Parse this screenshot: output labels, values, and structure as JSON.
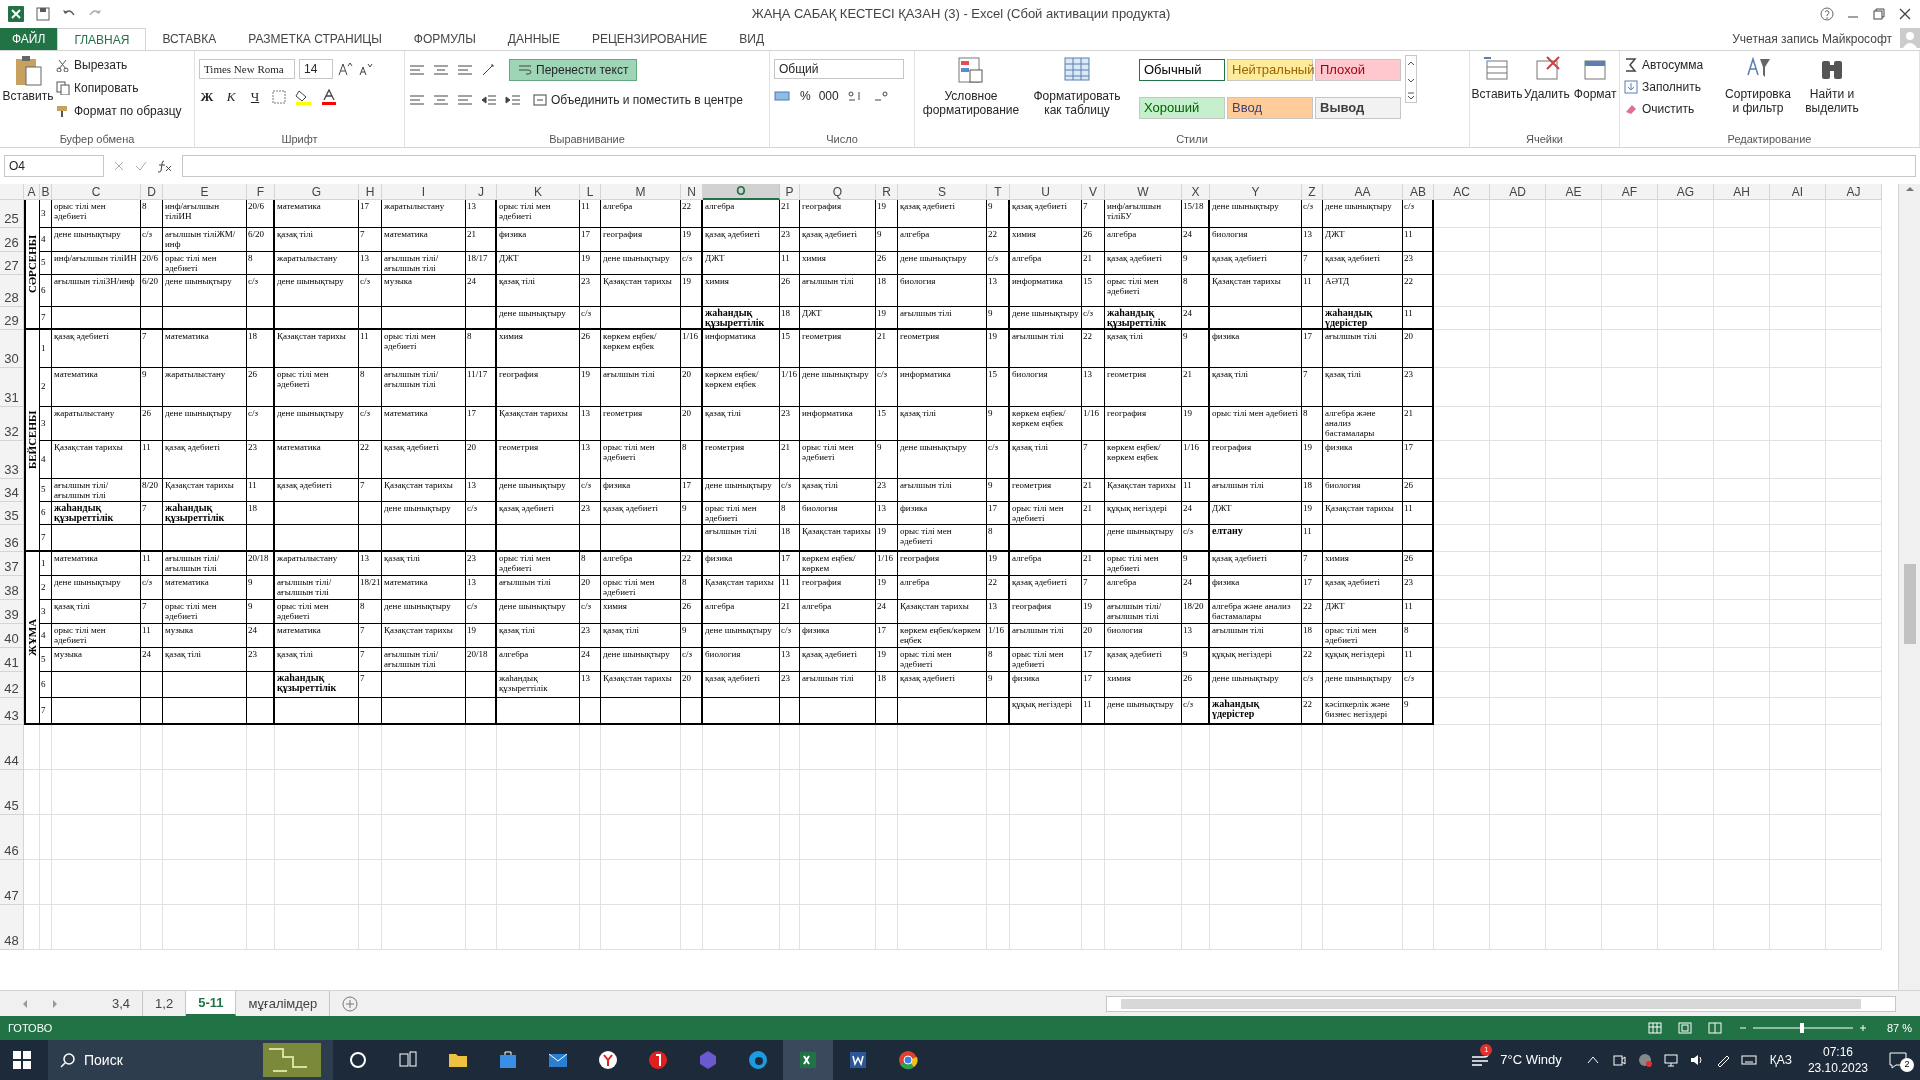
{
  "window": {
    "title": "ЖАҢА САБАҚ КЕСТЕСІ ҚАЗАН (3) - Excel (Сбой активации продукта)",
    "account": "Учетная запись Майкрософт"
  },
  "tabs": [
    {
      "label": "ФАЙЛ",
      "kind": "file",
      "selected": false
    },
    {
      "label": "ГЛАВНАЯ",
      "kind": "tab",
      "selected": true
    },
    {
      "label": "ВСТАВКА",
      "kind": "tab",
      "selected": false
    },
    {
      "label": "РАЗМЕТКА СТРАНИЦЫ",
      "kind": "tab",
      "selected": false
    },
    {
      "label": "ФОРМУЛЫ",
      "kind": "tab",
      "selected": false
    },
    {
      "label": "ДАННЫЕ",
      "kind": "tab",
      "selected": false
    },
    {
      "label": "РЕЦЕНЗИРОВАНИЕ",
      "kind": "tab",
      "selected": false
    },
    {
      "label": "ВИД",
      "kind": "tab",
      "selected": false
    }
  ],
  "ribbon": {
    "clipboard": {
      "label": "Буфер обмена",
      "paste": "Вставить",
      "items": [
        "Вырезать",
        "Копировать",
        "Формат по образцу"
      ]
    },
    "font": {
      "label": "Шрифт",
      "family": "Times New Roma",
      "size": "14",
      "styles": [
        "Ж",
        "К",
        "Ч"
      ]
    },
    "alignment": {
      "label": "Выравнивание",
      "wrap_text": {
        "text": "Перенести текст",
        "on": true
      },
      "merge": "Объединить и поместить в центре"
    },
    "number": {
      "label": "Число",
      "format": "Общий",
      "symbols": [
        "%",
        "000"
      ]
    },
    "styles": {
      "label": "Стили",
      "conditional": "Условное форматирование",
      "as_table": "Форматировать как таблицу",
      "cell_styles": [
        {
          "text": "Обычный",
          "color": "#ffffff"
        },
        {
          "text": "Нейтральный",
          "color": "#ffeb9c"
        },
        {
          "text": "Плохой",
          "color": "#ffc7ce"
        },
        {
          "text": "Хороший",
          "color": "#c6efce"
        },
        {
          "text": "Ввод",
          "color": "#ffcc99"
        },
        {
          "text": "Вывод",
          "color": "#f2f2f2"
        }
      ]
    },
    "cells": {
      "label": "Ячейки",
      "buttons": [
        "Вставить",
        "Удалить",
        "Формат"
      ]
    },
    "editing": {
      "label": "Редактирование",
      "items": [
        "Автосумма",
        "Заполнить",
        "Очистить"
      ],
      "buttons": [
        "Сортировка и фильтр",
        "Найти и выделить"
      ]
    }
  },
  "name_box": "O4",
  "columns": [
    {
      "letter": "A",
      "selected": false
    },
    {
      "letter": "B",
      "selected": false
    },
    {
      "letter": "C",
      "selected": false
    },
    {
      "letter": "D",
      "selected": false
    },
    {
      "letter": "E",
      "selected": false
    },
    {
      "letter": "F",
      "selected": false
    },
    {
      "letter": "G",
      "selected": false
    },
    {
      "letter": "H",
      "selected": false
    },
    {
      "letter": "I",
      "selected": false
    },
    {
      "letter": "J",
      "selected": false
    },
    {
      "letter": "K",
      "selected": false
    },
    {
      "letter": "L",
      "selected": false
    },
    {
      "letter": "M",
      "selected": false
    },
    {
      "letter": "N",
      "selected": false
    },
    {
      "letter": "O",
      "selected": true
    },
    {
      "letter": "P",
      "selected": false
    },
    {
      "letter": "Q",
      "selected": false
    },
    {
      "letter": "R",
      "selected": false
    },
    {
      "letter": "S",
      "selected": false
    },
    {
      "letter": "T",
      "selected": false
    },
    {
      "letter": "U",
      "selected": false
    },
    {
      "letter": "V",
      "selected": false
    },
    {
      "letter": "W",
      "selected": false
    },
    {
      "letter": "X",
      "selected": false
    },
    {
      "letter": "Y",
      "selected": false
    },
    {
      "letter": "Z",
      "selected": false
    },
    {
      "letter": "AA",
      "selected": false
    },
    {
      "letter": "AB",
      "selected": false
    },
    {
      "letter": "AC",
      "selected": false
    },
    {
      "letter": "AD",
      "selected": false
    },
    {
      "letter": "AE",
      "selected": false
    },
    {
      "letter": "AF",
      "selected": false
    },
    {
      "letter": "AG",
      "selected": false
    },
    {
      "letter": "AH",
      "selected": false
    },
    {
      "letter": "AI",
      "selected": false
    },
    {
      "letter": "AJ",
      "selected": false
    }
  ],
  "days": [
    {
      "day": "СӘРСЕНБІ",
      "lessons": [
        {
          "row": "25",
          "number": "3",
          "cells": [
            {
              "subject": "орыс тілі мен әдебиеті",
              "room": "8",
              "bold": false
            },
            {
              "subject": "инф/ағылшын тіліИН",
              "room": "20/6",
              "bold": false
            },
            {
              "subject": "математика",
              "room": "17",
              "bold": false
            },
            {
              "subject": "жаратылыстану",
              "room": "13",
              "bold": false
            },
            {
              "subject": "орыс тілі мен әдебиеті",
              "room": "11",
              "bold": false
            },
            {
              "subject": "алгебра",
              "room": "22",
              "bold": false
            },
            {
              "subject": "алгебра",
              "room": "21",
              "bold": false
            },
            {
              "subject": "география",
              "room": "19",
              "bold": false
            },
            {
              "subject": "қазақ әдебиеті",
              "room": "9",
              "bold": false
            },
            {
              "subject": "қазақ әдебиеті",
              "room": "7",
              "bold": false
            },
            {
              "subject": "инф/ағылшын тіліБУ",
              "room": "15/18",
              "bold": false
            },
            {
              "subject": "дене шынықтыру",
              "room": "с/з",
              "bold": false
            },
            {
              "subject": "дене шынықтыру",
              "room": "с/з",
              "bold": false
            }
          ]
        },
        {
          "row": "26",
          "number": "4",
          "cells": [
            {
              "subject": "дене шынықтыру",
              "room": "с/з",
              "bold": false
            },
            {
              "subject": "ағылшын тіліЖМ/инф",
              "room": "6/20",
              "bold": false
            },
            {
              "subject": "қазақ тілі",
              "room": "7",
              "bold": false
            },
            {
              "subject": "математика",
              "room": "21",
              "bold": false
            },
            {
              "subject": "физика",
              "room": "17",
              "bold": false
            },
            {
              "subject": "география",
              "room": "19",
              "bold": false
            },
            {
              "subject": "қазақ әдебиеті",
              "room": "23",
              "bold": false
            },
            {
              "subject": "қазақ әдебиеті",
              "room": "9",
              "bold": false
            },
            {
              "subject": "алгебра",
              "room": "22",
              "bold": false
            },
            {
              "subject": "химия",
              "room": "26",
              "bold": false
            },
            {
              "subject": "алгебра",
              "room": "24",
              "bold": false
            },
            {
              "subject": "биология",
              "room": "13",
              "bold": false
            },
            {
              "subject": "ДЖТ",
              "room": "11",
              "bold": false
            }
          ]
        },
        {
          "row": "27",
          "number": "5",
          "cells": [
            {
              "subject": "инф/ағылшын тіліИН",
              "room": "20/6",
              "bold": false
            },
            {
              "subject": "орыс тілі мен әдебиеті",
              "room": "8",
              "bold": false
            },
            {
              "subject": "жаратылыстану",
              "room": "13",
              "bold": false
            },
            {
              "subject": "ағылшын тілі/ағылшын тілі",
              "room": "18/17",
              "bold": false
            },
            {
              "subject": "ДЖТ",
              "room": "19",
              "bold": false
            },
            {
              "subject": "дене шынықтыру",
              "room": "с/з",
              "bold": false
            },
            {
              "subject": "ДЖТ",
              "room": "11",
              "bold": false
            },
            {
              "subject": "химия",
              "room": "26",
              "bold": false
            },
            {
              "subject": "дене шынықтыру",
              "room": "с/з",
              "bold": false
            },
            {
              "subject": "алгебра",
              "room": "21",
              "bold": false
            },
            {
              "subject": "қазақ әдебиеті",
              "room": "9",
              "bold": false
            },
            {
              "subject": "қазақ әдебиеті",
              "room": "7",
              "bold": false
            },
            {
              "subject": "қазақ әдебиеті",
              "room": "23",
              "bold": false
            }
          ]
        },
        {
          "row": "28",
          "number": "6",
          "cells": [
            {
              "subject": "ағылшын тіліЗН/инф",
              "room": "6/20",
              "bold": false
            },
            {
              "subject": "дене шынықтыру",
              "room": "с/з",
              "bold": false
            },
            {
              "subject": "дене шынықтыру",
              "room": "с/з",
              "bold": false
            },
            {
              "subject": "музыка",
              "room": "24",
              "bold": false
            },
            {
              "subject": "қазақ тілі",
              "room": "23",
              "bold": false
            },
            {
              "subject": "Қазақстан тарихы",
              "room": "19",
              "bold": false
            },
            {
              "subject": "химия",
              "room": "26",
              "bold": false
            },
            {
              "subject": "ағылшын тілі",
              "room": "18",
              "bold": false
            },
            {
              "subject": "биология",
              "room": "13",
              "bold": false
            },
            {
              "subject": "информатика",
              "room": "15",
              "bold": false
            },
            {
              "subject": "орыс тілі мен әдебиеті",
              "room": "8",
              "bold": false
            },
            {
              "subject": "Қазақстан тарихы",
              "room": "11",
              "bold": false
            },
            {
              "subject": "АӘТД",
              "room": "22",
              "bold": false
            }
          ]
        },
        {
          "row": "29",
          "number": "7",
          "cells": [
            null,
            null,
            null,
            null,
            {
              "subject": "дене шынықтыру",
              "room": "с/з",
              "bold": false
            },
            null,
            {
              "subject": "жаһандық құзыреттілік",
              "room": "18",
              "bold": true
            },
            {
              "subject": "ДЖТ",
              "room": "19",
              "bold": false
            },
            {
              "subject": "ағылшын тілі",
              "room": "9",
              "bold": false
            },
            {
              "subject": "дене шынықтыру",
              "room": "с/з",
              "bold": false
            },
            {
              "subject": "жаһандық құзыреттілік",
              "room": "24",
              "bold": true
            },
            null,
            {
              "subject": "жаһандық үдерістер",
              "room": "11",
              "bold": true
            }
          ]
        }
      ]
    },
    {
      "day": "БЕЙСЕНБІ",
      "lessons": [
        {
          "row": "30",
          "number": "1",
          "cells": [
            {
              "subject": "қазақ әдебиеті",
              "room": "7",
              "bold": false
            },
            {
              "subject": "математика",
              "room": "18",
              "bold": false
            },
            {
              "subject": "Қазақстан тарихы",
              "room": "11",
              "bold": false
            },
            {
              "subject": "орыс тілі мен әдебиеті",
              "room": "8",
              "bold": false
            },
            {
              "subject": "химия",
              "room": "26",
              "bold": false
            },
            {
              "subject": "көркем еңбек/көркем еңбек",
              "room": "1/16",
              "bold": false
            },
            {
              "subject": "информатика",
              "room": "15",
              "bold": false
            },
            {
              "subject": "геометрия",
              "room": "21",
              "bold": false
            },
            {
              "subject": "геометрия",
              "room": "19",
              "bold": false
            },
            {
              "subject": "ағылшын тілі",
              "room": "22",
              "bold": false
            },
            {
              "subject": "қазақ тілі",
              "room": "9",
              "bold": false
            },
            {
              "subject": "физика",
              "room": "17",
              "bold": false
            },
            {
              "subject": "ағылшын тілі",
              "room": "20",
              "bold": false
            }
          ]
        },
        {
          "row": "31",
          "number": "2",
          "cells": [
            {
              "subject": "математика",
              "room": "9",
              "bold": false
            },
            {
              "subject": "жаратылыстану",
              "room": "26",
              "bold": false
            },
            {
              "subject": "орыс тілі мен әдебиеті",
              "room": "8",
              "bold": false
            },
            {
              "subject": "ағылшын тілі/ағылшын тілі",
              "room": "11/17",
              "bold": false
            },
            {
              "subject": "география",
              "room": "19",
              "bold": false
            },
            {
              "subject": "ағылшын тілі",
              "room": "20",
              "bold": false
            },
            {
              "subject": "көркем еңбек/көркем еңбек",
              "room": "1/16",
              "bold": false
            },
            {
              "subject": "дене шынықтыру",
              "room": "с/з",
              "bold": false
            },
            {
              "subject": "информатика",
              "room": "15",
              "bold": false
            },
            {
              "subject": "биология",
              "room": "13",
              "bold": false
            },
            {
              "subject": "геометрия",
              "room": "21",
              "bold": false
            },
            {
              "subject": "қазақ тілі",
              "room": "7",
              "bold": false
            },
            {
              "subject": "қазақ тілі",
              "room": "23",
              "bold": false
            }
          ]
        },
        {
          "row": "32",
          "number": "3",
          "cells": [
            {
              "subject": "жаратылыстану",
              "room": "26",
              "bold": false
            },
            {
              "subject": "дене шынықтыру",
              "room": "с/з",
              "bold": false
            },
            {
              "subject": "дене шынықтыру",
              "room": "с/з",
              "bold": false
            },
            {
              "subject": "математика",
              "room": "17",
              "bold": false
            },
            {
              "subject": "Қазақстан тарихы",
              "room": "13",
              "bold": false
            },
            {
              "subject": "геометрия",
              "room": "20",
              "bold": false
            },
            {
              "subject": "қазақ тілі",
              "room": "23",
              "bold": false
            },
            {
              "subject": "информатика",
              "room": "15",
              "bold": false
            },
            {
              "subject": "қазақ тілі",
              "room": "9",
              "bold": false
            },
            {
              "subject": "көркем еңбек/көркем еңбек",
              "room": "1/16",
              "bold": false
            },
            {
              "subject": "география",
              "room": "19",
              "bold": false
            },
            {
              "subject": "орыс тілі мен әдебиеті",
              "room": "8",
              "bold": false
            },
            {
              "subject": "алгебра және анализ бастамалары",
              "room": "21",
              "bold": false
            }
          ]
        },
        {
          "row": "33",
          "number": "4",
          "cells": [
            {
              "subject": "Қазақстан тарихы",
              "room": "11",
              "bold": false
            },
            {
              "subject": "қазақ әдебиеті",
              "room": "23",
              "bold": false
            },
            {
              "subject": "математика",
              "room": "22",
              "bold": false
            },
            {
              "subject": "қазақ әдебиеті",
              "room": "20",
              "bold": false
            },
            {
              "subject": "геометрия",
              "room": "13",
              "bold": false
            },
            {
              "subject": "орыс тілі мен әдебиеті",
              "room": "8",
              "bold": false
            },
            {
              "subject": "геометрия",
              "room": "21",
              "bold": false
            },
            {
              "subject": "орыс тілі мен әдебиеті",
              "room": "9",
              "bold": false
            },
            {
              "subject": "дене шынықтыру",
              "room": "с/з",
              "bold": false
            },
            {
              "subject": "қазақ тілі",
              "room": "7",
              "bold": false
            },
            {
              "subject": "көркем еңбек/көркем еңбек",
              "room": "1/16",
              "bold": false
            },
            {
              "subject": "география",
              "room": "19",
              "bold": false
            },
            {
              "subject": "физика",
              "room": "17",
              "bold": false
            }
          ]
        },
        {
          "row": "34",
          "number": "5",
          "cells": [
            {
              "subject": "ағылшын тілі/ағылшын тілі",
              "room": "8/20",
              "bold": false
            },
            {
              "subject": "Қазақстан тарихы",
              "room": "11",
              "bold": false
            },
            {
              "subject": "қазақ әдебиеті",
              "room": "7",
              "bold": false
            },
            {
              "subject": "Қазақстан тарихы",
              "room": "13",
              "bold": false
            },
            {
              "subject": "дене шынықтыру",
              "room": "с/з",
              "bold": false
            },
            {
              "subject": "физика",
              "room": "17",
              "bold": false
            },
            {
              "subject": "дене шынықтыру",
              "room": "с/з",
              "bold": false
            },
            {
              "subject": "қазақ тілі",
              "room": "23",
              "bold": false
            },
            {
              "subject": "ағылшын тілі",
              "room": "9",
              "bold": false
            },
            {
              "subject": "геометрия",
              "room": "21",
              "bold": false
            },
            {
              "subject": "Қазақстан тарихы",
              "room": "11",
              "bold": false
            },
            {
              "subject": "ағылшын тілі",
              "room": "18",
              "bold": false
            },
            {
              "subject": "биология",
              "room": "26",
              "bold": false
            }
          ]
        },
        {
          "row": "35",
          "number": "6",
          "cells": [
            {
              "subject": "жаһандық құзыреттілік",
              "room": "7",
              "bold": true
            },
            {
              "subject": "жаһандық құзыреттілік",
              "room": "18",
              "bold": true
            },
            null,
            {
              "subject": "дене шынықтыру",
              "room": "с/з",
              "bold": false
            },
            {
              "subject": "қазақ әдебиеті",
              "room": "23",
              "bold": false
            },
            {
              "subject": "қазақ әдебиеті",
              "room": "9",
              "bold": false
            },
            {
              "subject": "орыс тілі мен әдебиеті",
              "room": "8",
              "bold": false
            },
            {
              "subject": "биология",
              "room": "13",
              "bold": false
            },
            {
              "subject": "физика",
              "room": "17",
              "bold": false
            },
            {
              "subject": "орыс тілі мен әдебиеті",
              "room": "21",
              "bold": false
            },
            {
              "subject": "құқық негіздері",
              "room": "24",
              "bold": false
            },
            {
              "subject": "ДЖТ",
              "room": "19",
              "bold": false
            },
            {
              "subject": "Қазақстан тарихы",
              "room": "11",
              "bold": false
            }
          ]
        },
        {
          "row": "36",
          "number": "7",
          "cells": [
            null,
            null,
            null,
            null,
            null,
            null,
            {
              "subject": "ағылшын тілі",
              "room": "18",
              "bold": false
            },
            {
              "subject": "Қазақстан тарихы",
              "room": "19",
              "bold": false
            },
            {
              "subject": "орыс тілі мен әдебиеті",
              "room": "8",
              "bold": false
            },
            null,
            {
              "subject": "дене шынықтыру",
              "room": "с/з",
              "bold": false
            },
            {
              "subject": "елтану",
              "room": "11",
              "bold": true
            },
            null
          ]
        }
      ]
    },
    {
      "day": "ЖҰМА",
      "lessons": [
        {
          "row": "37",
          "number": "1",
          "cells": [
            {
              "subject": "математика",
              "room": "11",
              "bold": false
            },
            {
              "subject": "ағылшын тілі/ағылшын тілі",
              "room": "20/18",
              "bold": false
            },
            {
              "subject": "жаратылыстану",
              "room": "13",
              "bold": false
            },
            {
              "subject": "қазақ тілі",
              "room": "23",
              "bold": false
            },
            {
              "subject": "орыс тілі мен әдебиеті",
              "room": "8",
              "bold": false
            },
            {
              "subject": "алгебра",
              "room": "22",
              "bold": false
            },
            {
              "subject": "физика",
              "room": "17",
              "bold": false
            },
            {
              "subject": "көркем еңбек/көркем",
              "room": "1/16",
              "bold": false
            },
            {
              "subject": "география",
              "room": "19",
              "bold": false
            },
            {
              "subject": "алгебра",
              "room": "21",
              "bold": false
            },
            {
              "subject": "орыс тілі мен әдебиеті",
              "room": "9",
              "bold": false
            },
            {
              "subject": "қазақ әдебиеті",
              "room": "7",
              "bold": false
            },
            {
              "subject": "химия",
              "room": "26",
              "bold": false
            }
          ]
        },
        {
          "row": "38",
          "number": "2",
          "cells": [
            {
              "subject": "дене шынықтыру",
              "room": "с/з",
              "bold": false
            },
            {
              "subject": "математика",
              "room": "9",
              "bold": false
            },
            {
              "subject": "ағылшын тілі/ағылшын тілі",
              "room": "18/21",
              "bold": false
            },
            {
              "subject": "математика",
              "room": "13",
              "bold": false
            },
            {
              "subject": "ағылшын тілі",
              "room": "20",
              "bold": false
            },
            {
              "subject": "орыс тілі мен әдебиеті",
              "room": "8",
              "bold": false
            },
            {
              "subject": "Қазақстан тарихы",
              "room": "11",
              "bold": false
            },
            {
              "subject": "география",
              "room": "19",
              "bold": false
            },
            {
              "subject": "алгебра",
              "room": "22",
              "bold": false
            },
            {
              "subject": "қазақ әдебиеті",
              "room": "7",
              "bold": false
            },
            {
              "subject": "алгебра",
              "room": "24",
              "bold": false
            },
            {
              "subject": "физика",
              "room": "17",
              "bold": false
            },
            {
              "subject": "қазақ әдебиеті",
              "room": "23",
              "bold": false
            }
          ]
        },
        {
          "row": "39",
          "number": "3",
          "cells": [
            {
              "subject": "қазақ тілі",
              "room": "7",
              "bold": false
            },
            {
              "subject": "орыс тілі мен әдебиеті",
              "room": "9",
              "bold": false
            },
            {
              "subject": "орыс тілі мен әдебиеті",
              "room": "8",
              "bold": false
            },
            {
              "subject": "дене шынықтыру",
              "room": "с/з",
              "bold": false
            },
            {
              "subject": "дене шынықтыру",
              "room": "с/з",
              "bold": false
            },
            {
              "subject": "химия",
              "room": "26",
              "bold": false
            },
            {
              "subject": "алгебра",
              "room": "21",
              "bold": false
            },
            {
              "subject": "алгебра",
              "room": "24",
              "bold": false
            },
            {
              "subject": "Қазақстан тарихы",
              "room": "13",
              "bold": false
            },
            {
              "subject": "география",
              "room": "19",
              "bold": false
            },
            {
              "subject": "ағылшын тілі/ағылшын тілі",
              "room": "18/20",
              "bold": false
            },
            {
              "subject": "алгебра және анализ бастамалары",
              "room": "22",
              "bold": false
            },
            {
              "subject": "ДЖТ",
              "room": "11",
              "bold": false
            }
          ]
        },
        {
          "row": "40",
          "number": "4",
          "cells": [
            {
              "subject": "орыс тілі мен әдебиеті",
              "room": "11",
              "bold": false
            },
            {
              "subject": "музыка",
              "room": "24",
              "bold": false
            },
            {
              "subject": "математика",
              "room": "7",
              "bold": false
            },
            {
              "subject": "Қазақстан тарихы",
              "room": "19",
              "bold": false
            },
            {
              "subject": "қазақ тілі",
              "room": "23",
              "bold": false
            },
            {
              "subject": "қазақ тілі",
              "room": "9",
              "bold": false
            },
            {
              "subject": "дене шынықтыру",
              "room": "с/з",
              "bold": false
            },
            {
              "subject": "физика",
              "room": "17",
              "bold": false
            },
            {
              "subject": "көркем еңбек/көркем еңбек",
              "room": "1/16",
              "bold": false
            },
            {
              "subject": "ағылшын тілі",
              "room": "20",
              "bold": false
            },
            {
              "subject": "биология",
              "room": "13",
              "bold": false
            },
            {
              "subject": "ағылшын тілі",
              "room": "18",
              "bold": false
            },
            {
              "subject": "орыс тілі мен әдебиеті",
              "room": "8",
              "bold": false
            }
          ]
        },
        {
          "row": "41",
          "number": "5",
          "cells": [
            {
              "subject": "музыка",
              "room": "24",
              "bold": false
            },
            {
              "subject": "қазақ тілі",
              "room": "23",
              "bold": false
            },
            {
              "subject": "қазақ тілі",
              "room": "7",
              "bold": false
            },
            {
              "subject": "ағылшын тілі/ағылшын тілі",
              "room": "20/18",
              "bold": false
            },
            {
              "subject": "алгебра",
              "room": "24",
              "bold": false
            },
            {
              "subject": "дене шынықтыру",
              "room": "с/з",
              "bold": false
            },
            {
              "subject": "биология",
              "room": "13",
              "bold": false
            },
            {
              "subject": "қазақ әдебиеті",
              "room": "19",
              "bold": false
            },
            {
              "subject": "орыс тілі мен әдебиеті",
              "room": "8",
              "bold": false
            },
            {
              "subject": "орыс тілі мен әдебиеті",
              "room": "17",
              "bold": false
            },
            {
              "subject": "қазақ әдебиеті",
              "room": "9",
              "bold": false
            },
            {
              "subject": "құқық негіздері",
              "room": "22",
              "bold": false
            },
            {
              "subject": "құқық негіздері",
              "room": "11",
              "bold": false
            }
          ]
        },
        {
          "row": "42",
          "number": "6",
          "cells": [
            null,
            null,
            {
              "subject": "жаһандық құзыреттілік",
              "room": "7",
              "bold": true
            },
            null,
            {
              "subject": "жаһандық құзыреттілік",
              "room": "13",
              "bold": false
            },
            {
              "subject": "Қазақстан тарихы",
              "room": "20",
              "bold": false
            },
            {
              "subject": "қазақ әдебиеті",
              "room": "23",
              "bold": false
            },
            {
              "subject": "ағылшын тілі",
              "room": "18",
              "bold": false
            },
            {
              "subject": "қазақ әдебиеті",
              "room": "9",
              "bold": false
            },
            {
              "subject": "физика",
              "room": "17",
              "bold": false
            },
            {
              "subject": "химия",
              "room": "26",
              "bold": false
            },
            {
              "subject": "дене шынықтыру",
              "room": "с/з",
              "bold": false
            },
            {
              "subject": "дене шынықтыру",
              "room": "с/з",
              "bold": false
            }
          ]
        },
        {
          "row": "43",
          "number": "7",
          "cells": [
            null,
            null,
            null,
            null,
            null,
            null,
            null,
            null,
            null,
            {
              "subject": "құқық негіздері",
              "room": "11",
              "bold": false
            },
            {
              "subject": "дене шынықтыру",
              "room": "с/з",
              "bold": false
            },
            {
              "subject": "жаһандық үдерістер",
              "room": "22",
              "bold": true
            },
            {
              "subject": "кәсіпкерлік және бизнес негіздері",
              "room": "9",
              "bold": false
            }
          ]
        }
      ]
    }
  ],
  "empty_rows": [
    "44",
    "45",
    "46",
    "47",
    "48"
  ],
  "sheet_tabs": [
    {
      "label": "3,4",
      "selected": false
    },
    {
      "label": "1,2",
      "selected": false
    },
    {
      "label": "5-11",
      "selected": true
    },
    {
      "label": "мұғалімдер",
      "selected": false
    }
  ],
  "status_bar": {
    "state": "ГОТОВО",
    "zoom": "87 %"
  },
  "taskbar": {
    "search": "Поиск",
    "weather": "7°C Windy",
    "weather_badge": "1",
    "language": "ҚАЗ",
    "time": "07:16",
    "date": "23.10.2023",
    "notifications": "2"
  }
}
